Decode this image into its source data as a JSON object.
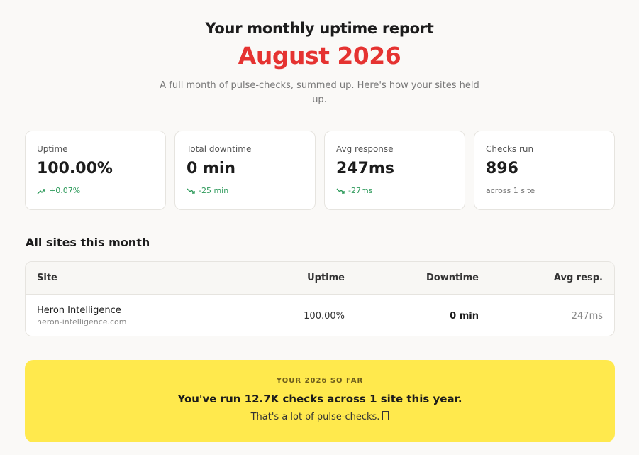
{
  "header": {
    "title": "Your monthly uptime report",
    "month": "August 2026",
    "subtitle": "A full month of pulse-checks, summed up. Here's how your sites held up."
  },
  "stats": [
    {
      "label": "Uptime",
      "value": "100.00%",
      "delta": "+0.07%",
      "trend": "up"
    },
    {
      "label": "Total downtime",
      "value": "0 min",
      "delta": "-25 min",
      "trend": "down"
    },
    {
      "label": "Avg response",
      "value": "247ms",
      "delta": "-27ms",
      "trend": "down"
    },
    {
      "label": "Checks run",
      "value": "896",
      "note": "across 1 site"
    }
  ],
  "sites": {
    "title": "All sites this month",
    "columns": {
      "site": "Site",
      "uptime": "Uptime",
      "downtime": "Downtime",
      "avg_resp": "Avg resp."
    },
    "rows": [
      {
        "name": "Heron Intelligence",
        "host": "heron-intelligence.com",
        "uptime": "100.00%",
        "downtime": "0 min",
        "avg_resp": "247ms"
      }
    ]
  },
  "year_banner": {
    "eyebrow": "YOUR 2026 SO FAR",
    "headline": "You've run 12.7K checks across 1 site this year.",
    "sub": "That's a lot of pulse-checks."
  },
  "colors": {
    "accent": "#e53331",
    "positive": "#2e9a5b",
    "banner": "#ffe94d"
  }
}
